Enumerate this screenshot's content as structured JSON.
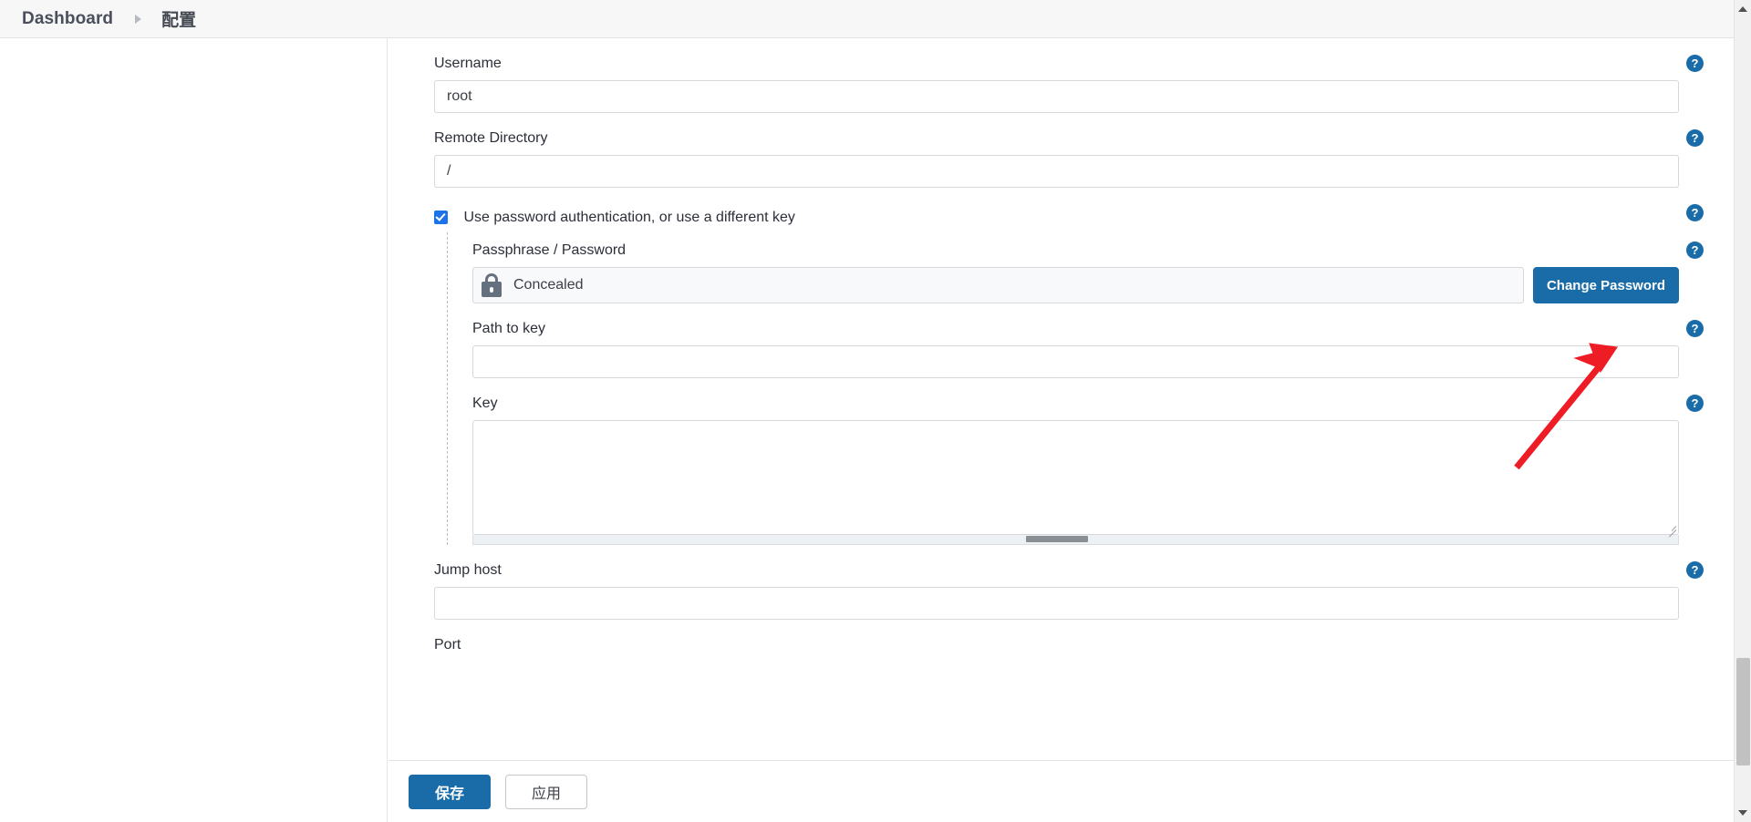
{
  "breadcrumb": {
    "home": "Dashboard",
    "separator_icon": "chevron-right-icon",
    "current": "配置"
  },
  "form": {
    "help_icon_glyph": "?",
    "fields": [
      {
        "label": "Username",
        "value": "root",
        "placeholder": ""
      },
      {
        "label": "Remote Directory",
        "value": "/",
        "placeholder": ""
      }
    ],
    "checkbox": {
      "label": "Use password authentication, or use a different key",
      "checked": true
    },
    "password": {
      "label": "Passphrase / Password",
      "icon": "lock-icon",
      "value": "Concealed",
      "button_label": "Change Password"
    },
    "path_to_key": {
      "label": "Path to key",
      "value": "",
      "placeholder": ""
    },
    "key": {
      "label": "Key",
      "value": "",
      "placeholder": ""
    },
    "jump_host": {
      "label": "Jump host",
      "value": "",
      "placeholder": ""
    },
    "port": {
      "label": "Port"
    }
  },
  "footer": {
    "save_label": "保存",
    "apply_label": "应用"
  },
  "colors": {
    "accent_blue": "#1a6ca8",
    "checkbox_blue": "#1a73e8",
    "help_blue": "#1a6ca8",
    "annotation_red": "#ee1c25",
    "header_bg": "#f7f7f8"
  },
  "annotation": {
    "type": "arrow",
    "points_to": "Change Password"
  }
}
